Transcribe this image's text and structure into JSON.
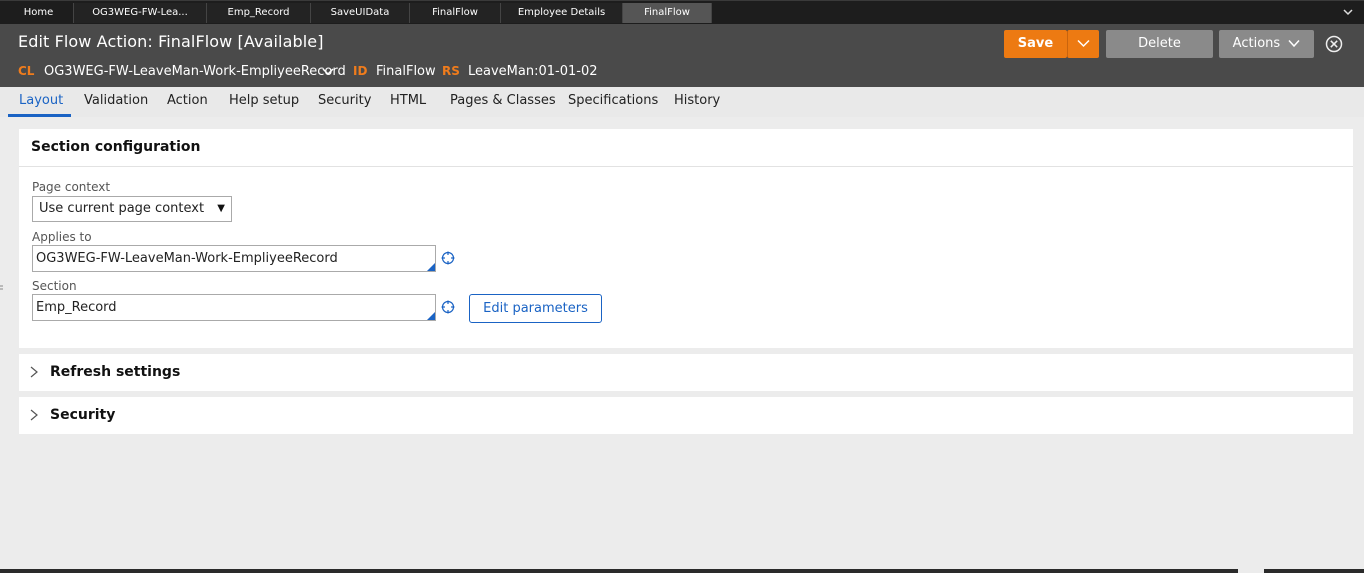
{
  "tabs": [
    {
      "label": "Home"
    },
    {
      "label": "OG3WEG-FW-Lea..."
    },
    {
      "label": "Emp_Record"
    },
    {
      "label": "SaveUIData"
    },
    {
      "label": "FinalFlow"
    },
    {
      "label": "Employee Details"
    },
    {
      "label": "FinalFlow"
    }
  ],
  "header": {
    "title": "Edit  Flow Action: FinalFlow [Available]",
    "cl_key": "CL",
    "cl_value": "OG3WEG-FW-LeaveMan-Work-EmpliyeeRecord",
    "id_key": "ID",
    "id_value": "FinalFlow",
    "rs_key": "RS",
    "rs_value": "LeaveMan:01-01-02",
    "save_label": "Save",
    "delete_label": "Delete",
    "actions_label": "Actions"
  },
  "rule_tabs": [
    {
      "label": "Layout"
    },
    {
      "label": "Validation"
    },
    {
      "label": "Action"
    },
    {
      "label": "Help setup"
    },
    {
      "label": "Security"
    },
    {
      "label": "HTML"
    },
    {
      "label": "Pages & Classes"
    },
    {
      "label": "Specifications"
    },
    {
      "label": "History"
    }
  ],
  "section_config": {
    "title": "Section configuration",
    "page_context_label": "Page context",
    "page_context_value": "Use current page context",
    "applies_to_label": "Applies to",
    "applies_to_value": "OG3WEG-FW-LeaveMan-Work-EmpliyeeRecord",
    "section_label": "Section",
    "section_value": "Emp_Record",
    "edit_parameters_label": "Edit parameters"
  },
  "refresh_settings": {
    "title": "Refresh settings"
  },
  "security": {
    "title": "Security"
  },
  "colors": {
    "accent_orange": "#ed7a12",
    "link_blue": "#1a63c4",
    "header_bg": "#4a4a4a",
    "tabbar_bg": "#1d1d1d"
  }
}
